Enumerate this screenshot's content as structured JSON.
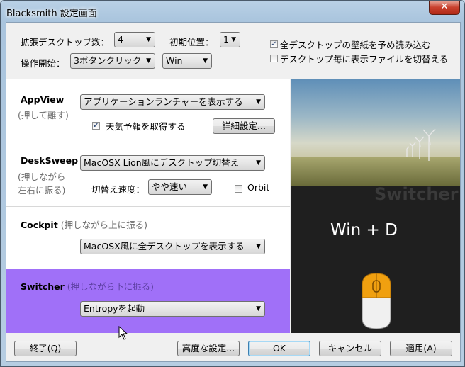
{
  "window": {
    "title": "Blacksmith 設定画面",
    "close_glyph": "✕"
  },
  "top": {
    "desktops_label": "拡張デスクトップ数：",
    "desktops_value": "4",
    "initial_label": "初期位置：",
    "initial_value": "1",
    "op_label": "操作開始：",
    "op_value": "3ボタンクリック",
    "key_value": "Win",
    "preload_wallpaper": {
      "label": "全デスクトップの壁紙を予め読み込む",
      "checked": true
    },
    "switch_files": {
      "label": "デスクトップ毎に表示ファイルを切替える",
      "checked": false
    }
  },
  "appview": {
    "name": "AppView",
    "sub": "(押して離す)",
    "select": "アプリケーションランチャーを表示する",
    "weather": {
      "label": "天気予報を取得する",
      "checked": true
    },
    "detail_button": "詳細設定..."
  },
  "desksweep": {
    "name": "DeskSweep",
    "sub1": "(押しながら",
    "sub2": "左右に振る)",
    "select": "MacOSX Lion風にデスクトップ切替え",
    "speed_label": "切替え速度：",
    "speed_value": "やや速い",
    "orbit": {
      "label": "Orbit",
      "checked": false
    }
  },
  "cockpit": {
    "name": "Cockpit",
    "sub": "(押しながら上に振る)",
    "select": "MacOSX風に全デスクトップを表示する"
  },
  "switcher": {
    "name": "Switcher",
    "sub": "(押しながら下に振る)",
    "select": "Entropyを起動",
    "highlight_color": "#a070f8"
  },
  "preview": {
    "title": "Switcher",
    "keys": "Win + D",
    "accent_color": "#f0a010"
  },
  "footer": {
    "quit": "終了(Q)",
    "advanced": "高度な設定...",
    "ok": "OK",
    "cancel": "キャンセル",
    "apply": "適用(A)"
  }
}
